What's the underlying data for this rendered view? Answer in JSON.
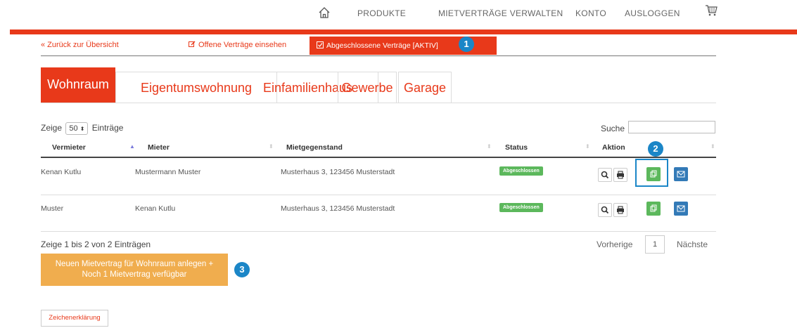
{
  "topnav": {
    "home_icon": "home-icon",
    "links": [
      "PRODUKTE",
      "MIETVERTRÄGE VERWALTEN",
      "KONTO",
      "AUSLOGGEN"
    ],
    "cart_icon": "cart-icon"
  },
  "colors": {
    "accent": "#e8391a",
    "success": "#5cb85c",
    "primary": "#337ab7",
    "warning": "#f0ad4e",
    "callout": "#1b86c7"
  },
  "subnav": {
    "back_label": "« Zurück zur Übersicht",
    "open_label": "Offene Verträge einsehen",
    "active_label": "Abgeschlossene Verträge [AKTIV]",
    "open_icon": "edit-icon",
    "active_icon": "check-square-icon"
  },
  "callouts": [
    "1",
    "2",
    "3"
  ],
  "tabs": [
    "Wohnraum",
    "Eigentumswohnung",
    "Einfamilienhaus",
    "Gewerbe",
    "Garage"
  ],
  "active_tab": "Wohnraum",
  "table": {
    "show_prefix": "Zeige",
    "page_size": "50",
    "show_suffix": "Einträge",
    "search_label": "Suche",
    "search_value": "",
    "columns": [
      "Vermieter",
      "Mieter",
      "Mietgegenstand",
      "Status",
      "Aktion"
    ],
    "rows": [
      {
        "vermieter": "Kenan Kutlu",
        "mieter": "Mustermann Muster",
        "mietgegenstand": "Musterhaus 3, 123456 Musterstadt",
        "status": "Abgeschlossen"
      },
      {
        "vermieter": "Muster",
        "mieter": "Kenan Kutlu",
        "mietgegenstand": "Musterhaus 3, 123456 Musterstadt",
        "status": "Abgeschlossen"
      }
    ],
    "action_icons": [
      "search-icon",
      "print-icon",
      "copy-icon",
      "envelope-icon"
    ]
  },
  "footer": {
    "info": "Zeige 1 bis 2 von 2 Einträgen",
    "prev": "Vorherige",
    "page": "1",
    "next": "Nächste",
    "new_button_line1": "Neuen Mietvertrag für Wohnraum anlegen +",
    "new_button_line2": "Noch 1 Mietvertrag verfügbar",
    "legend_button": "Zeichenerklärung"
  }
}
